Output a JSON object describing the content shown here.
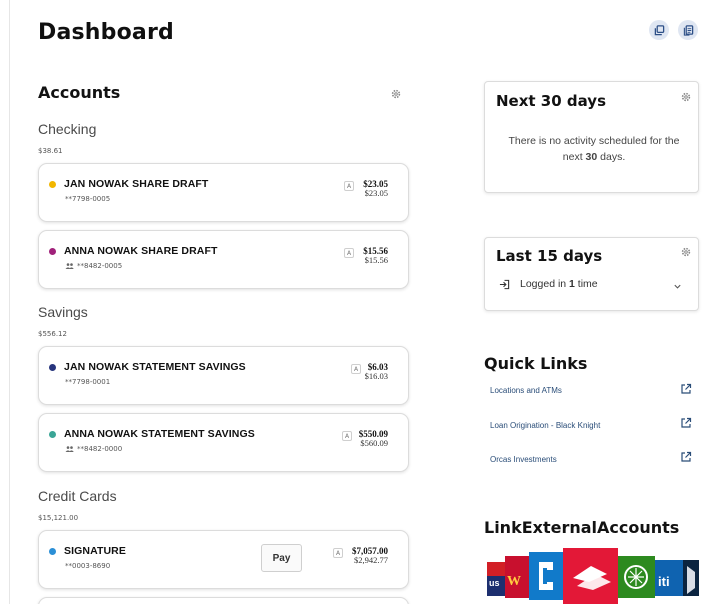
{
  "page": {
    "title": "Dashboard"
  },
  "accounts": {
    "title": "Accounts",
    "groups": [
      {
        "label": "Checking",
        "total": "$38.61",
        "items": [
          {
            "name": "JAN NOWAK SHARE DRAFT",
            "number": "**7798-0005",
            "joint": false,
            "badge": "A",
            "available": "$23.05",
            "current": "$23.05",
            "color": "#f2b600"
          },
          {
            "name": "ANNA NOWAK SHARE DRAFT",
            "number": "**8482-0005",
            "joint": true,
            "badge": "A",
            "available": "$15.56",
            "current": "$15.56",
            "color": "#a0217a"
          }
        ]
      },
      {
        "label": "Savings",
        "total": "$556.12",
        "items": [
          {
            "name": "JAN NOWAK STATEMENT SAVINGS",
            "number": "**7798-0001",
            "joint": false,
            "badge": "A",
            "available": "$6.03",
            "current": "$16.03",
            "color": "#27357d"
          },
          {
            "name": "ANNA NOWAK STATEMENT SAVINGS",
            "number": "**8482-0000",
            "joint": true,
            "badge": "A",
            "available": "$550.09",
            "current": "$560.09",
            "color": "#3aa596"
          }
        ]
      },
      {
        "label": "Credit Cards",
        "total": "$15,121.00",
        "items": [
          {
            "name": "SIGNATURE",
            "number": "**0003-8690",
            "joint": false,
            "badge": "A",
            "available": "$7,057.00",
            "current": "$2,942.77",
            "color": "#2b8fd6",
            "pay_label": "Pay"
          }
        ]
      }
    ]
  },
  "next30": {
    "title": "Next 30 days",
    "msg_before": "There is no activity scheduled for the next ",
    "msg_bold": "30",
    "msg_after": " days."
  },
  "last15": {
    "title": "Last 15 days",
    "login_before": "Logged in ",
    "login_count": "1",
    "login_after": " time"
  },
  "quick_links": {
    "title": "Quick Links",
    "items": [
      {
        "label": "Locations and ATMs"
      },
      {
        "label": "Loan Origination - Black Knight"
      },
      {
        "label": "Orcas Investments"
      }
    ]
  },
  "external": {
    "title": "LinkExternalAccounts",
    "logos": [
      "us",
      "W",
      "C",
      "BofA",
      "TD",
      "iti",
      "USAA"
    ]
  },
  "icons": {
    "header_buttons": [
      "copy-icon",
      "document-icon"
    ],
    "settings": "gear-icon",
    "link": "external-link-icon"
  }
}
